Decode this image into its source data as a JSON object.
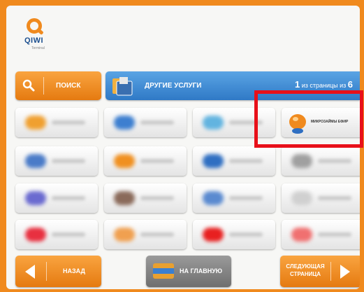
{
  "logo": {
    "text": "QIWI",
    "sub": "Terminal"
  },
  "search": {
    "label": "ПОИСК"
  },
  "header": {
    "title": "ДРУГИЕ УСЛУГИ",
    "page_current": "1",
    "page_mid": " из страницы из ",
    "page_total": "6"
  },
  "tiles": {
    "highlighted": {
      "label": "МИКРОЗАЙМЫ ЕФИР",
      "icon": "orange-bubble-icon"
    },
    "blurred_colors": [
      [
        "#f0a030",
        "#3d7fd0",
        "#62b4e0",
        null
      ],
      [
        "#4a7bc8",
        "#f09020",
        "#2f6fc2",
        "#a0a0a0"
      ],
      [
        "#6a6ad0",
        "#8a6a5a",
        "#5a8ad0",
        "#d0d0d0"
      ],
      [
        "#e83040",
        "#f0a050",
        "#e82020",
        "#f07070"
      ]
    ]
  },
  "nav": {
    "back_label": "НАЗАД",
    "home_label": "НА ГЛАВНУЮ",
    "next_label": "СЛЕДУЮЩАЯ СТРАНИЦА"
  },
  "colors": {
    "accent": "#f08a1e",
    "highlight": "#e8101a",
    "header": "#2f79c6"
  }
}
